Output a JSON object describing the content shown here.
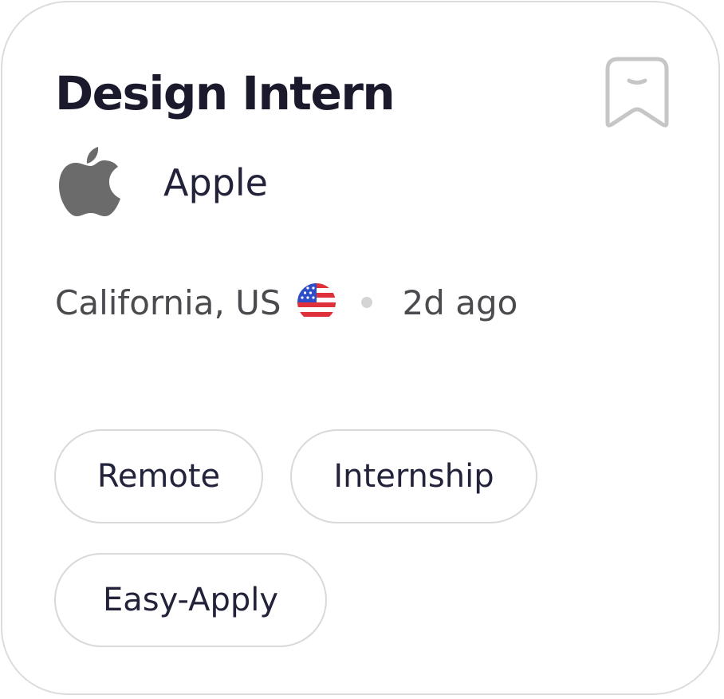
{
  "job": {
    "title": "Design Intern",
    "company": "Apple",
    "company_logo_icon": "apple-logo-icon",
    "location": "California, US",
    "country_flag_icon": "us-flag-icon",
    "posted": "2d ago",
    "bookmark_icon": "bookmark-icon"
  },
  "tags": [
    {
      "label": "Remote"
    },
    {
      "label": "Internship"
    },
    {
      "label": "Easy-Apply"
    }
  ],
  "colors": {
    "title_text": "#1a1a2c",
    "secondary_text": "#4b4b4f",
    "border": "#dcdcdc",
    "logo_gray": "#6b6b6b",
    "flag_red": "#e0303c",
    "flag_blue": "#2d4ec8"
  }
}
